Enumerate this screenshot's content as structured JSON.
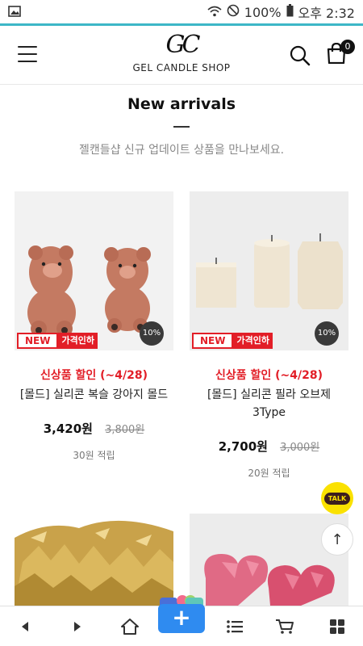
{
  "status_bar": {
    "battery": "100%",
    "time": "오후 2:32"
  },
  "header": {
    "logo_mark": "GC",
    "shop_name": "GEL CANDLE SHOP",
    "cart_count": "0"
  },
  "section": {
    "title": "New arrivals",
    "subtitle": "젤캔들샵 신규 업데이트 상품을 만나보세요."
  },
  "products": [
    {
      "badge_new": "NEW",
      "badge_price": "가격인하",
      "discount": "10%",
      "promo": "신상품 할인 (~4/28)",
      "name": "[몰드] 실리콘 복슬 강아지 몰드",
      "price": "3,420원",
      "original_price": "3,800원",
      "points": "30원 적립"
    },
    {
      "badge_new": "NEW",
      "badge_price": "가격인하",
      "discount": "10%",
      "promo": "신상품 할인 (~4/28)",
      "name": "[몰드] 실리콘 필라 오브제 3Type",
      "price": "2,700원",
      "original_price": "3,000원",
      "points": "20원 적립"
    }
  ],
  "floating": {
    "talk_label": "TALK",
    "top_arrow": "↑"
  },
  "bottom_nav": {
    "plus": "+"
  },
  "colors": {
    "accent_red": "#e21e27",
    "status_teal": "#3db7c7",
    "plus_blue": "#2f8bf0",
    "kakao_yellow": "#fae100"
  }
}
